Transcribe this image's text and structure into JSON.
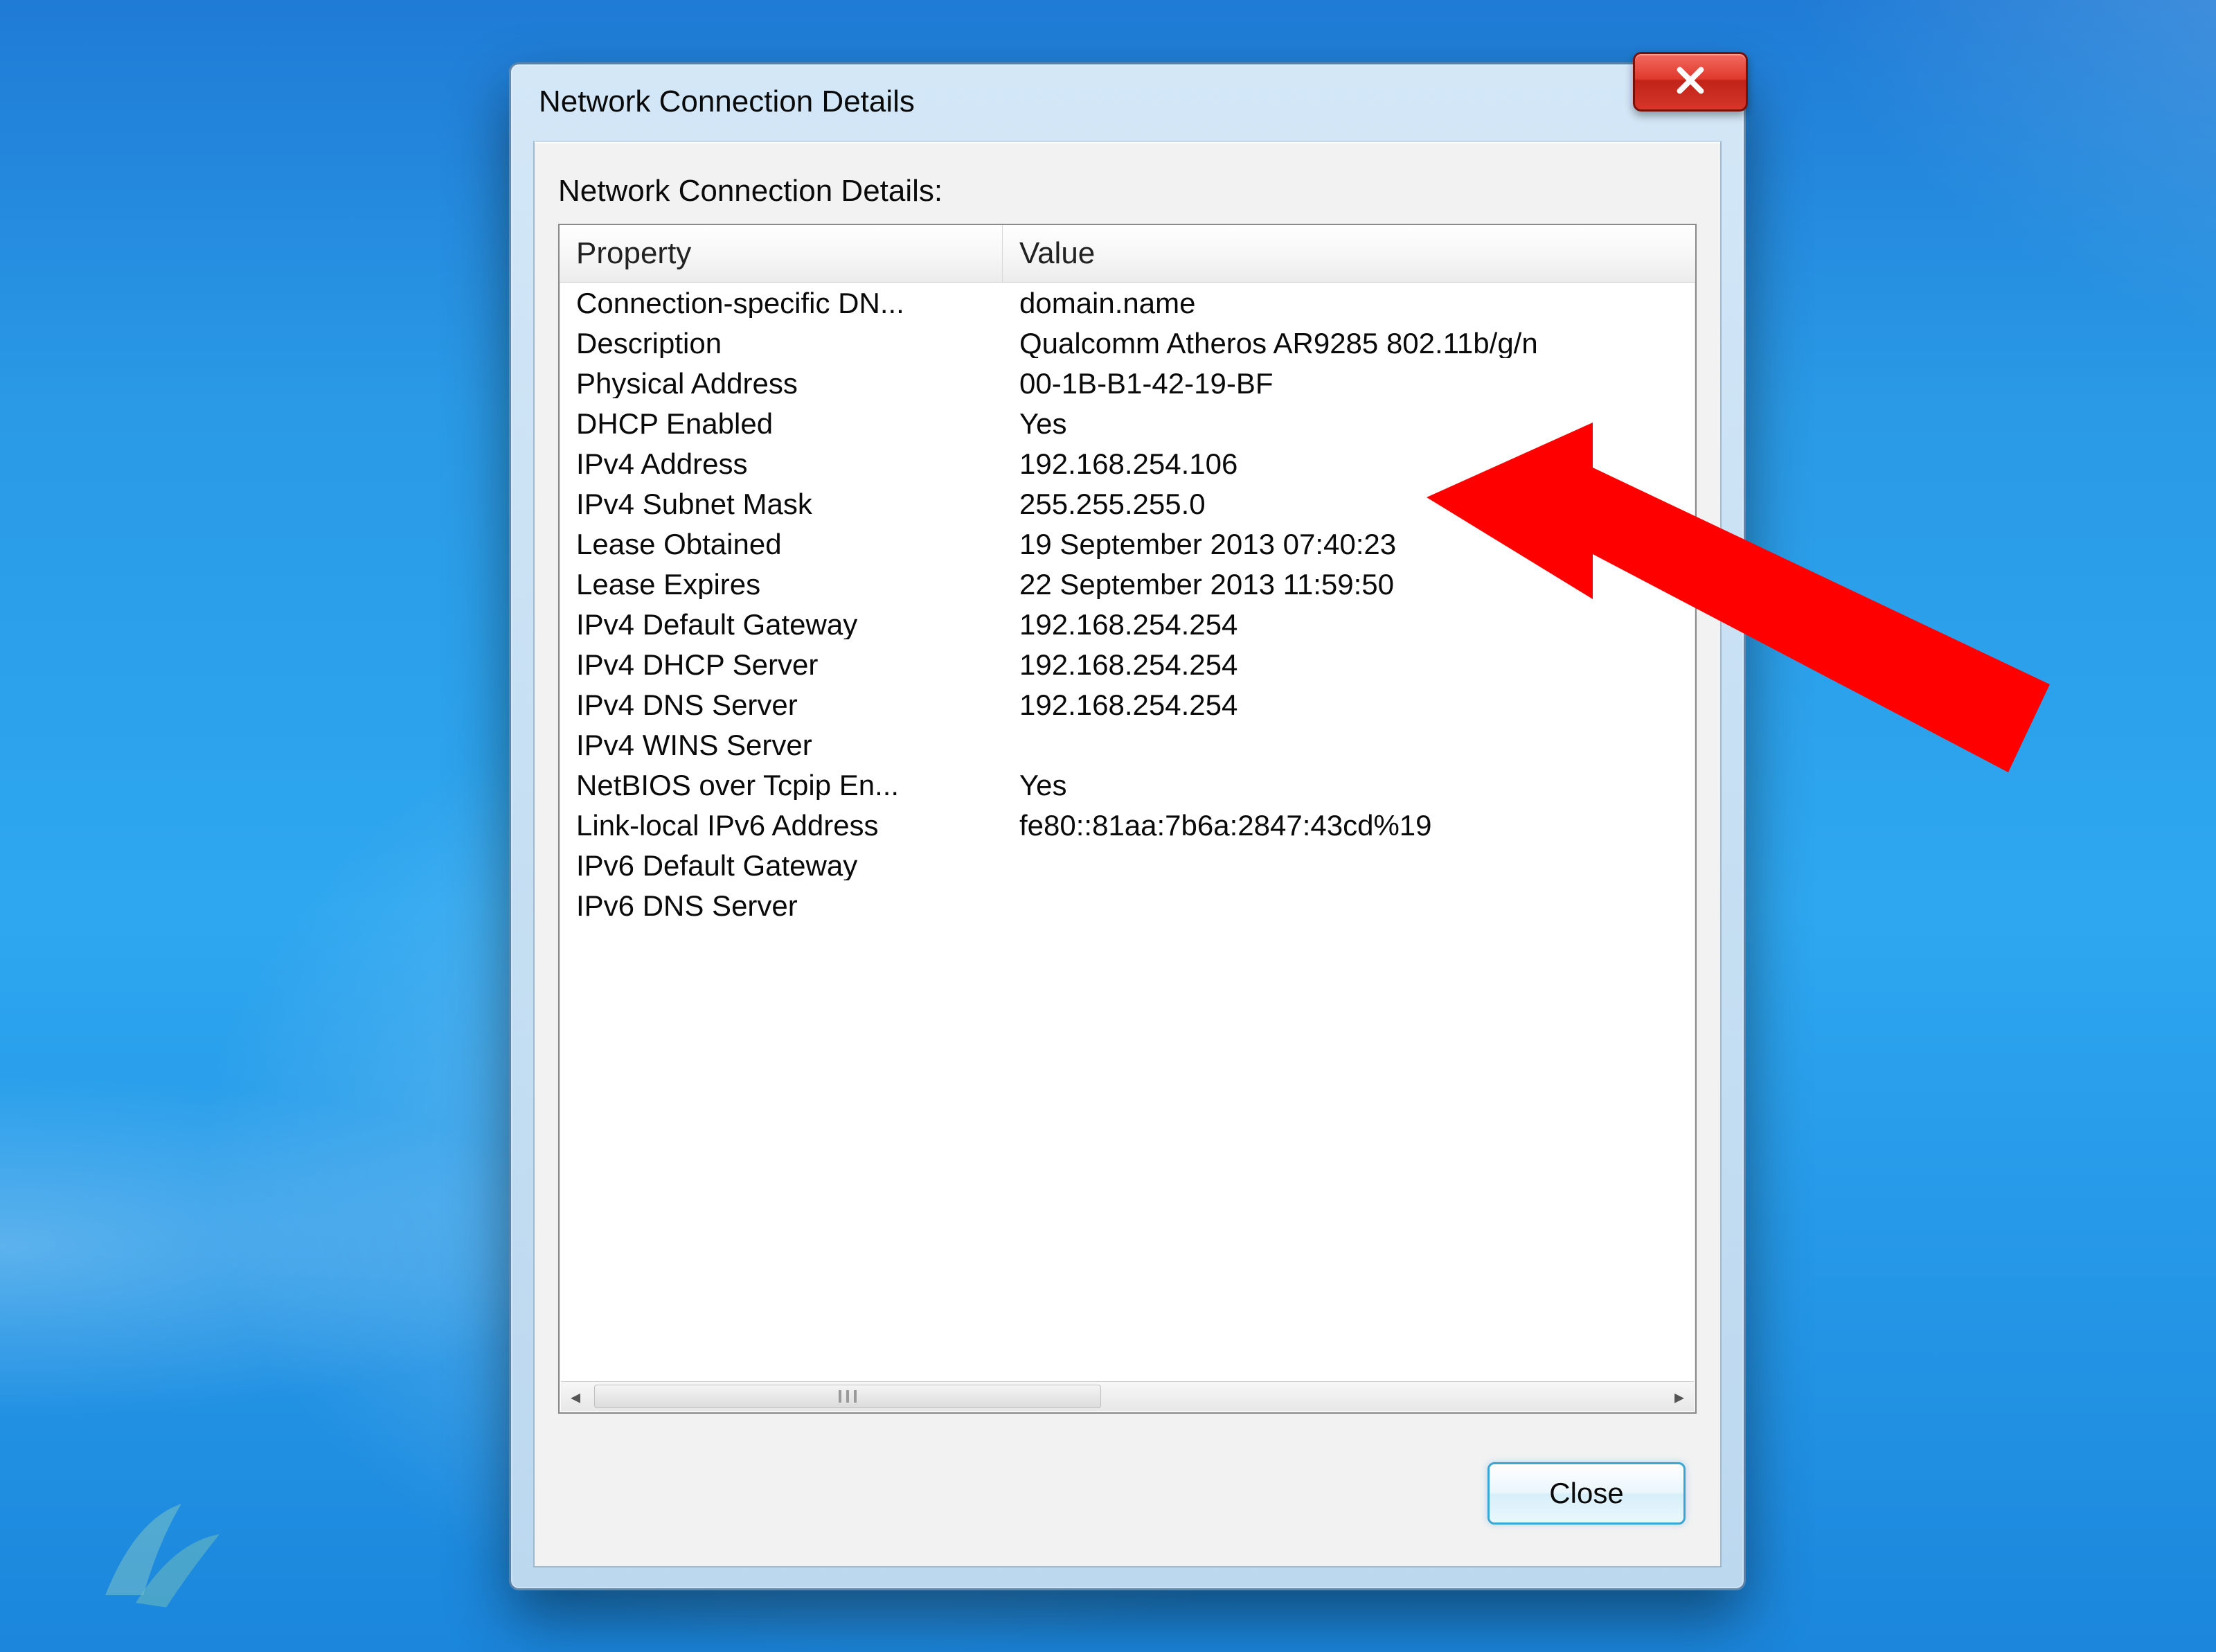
{
  "window": {
    "title": "Network Connection Details",
    "close_glyph": "X"
  },
  "section": {
    "label": "Network Connection Details:"
  },
  "columns": {
    "property": "Property",
    "value": "Value"
  },
  "rows": [
    {
      "property": "Connection-specific DN...",
      "value": "domain.name"
    },
    {
      "property": "Description",
      "value": "Qualcomm Atheros AR9285 802.11b/g/n"
    },
    {
      "property": "Physical Address",
      "value": "00-1B-B1-42-19-BF"
    },
    {
      "property": "DHCP Enabled",
      "value": "Yes"
    },
    {
      "property": "IPv4 Address",
      "value": "192.168.254.106"
    },
    {
      "property": "IPv4 Subnet Mask",
      "value": "255.255.255.0"
    },
    {
      "property": "Lease Obtained",
      "value": "19 September 2013 07:40:23"
    },
    {
      "property": "Lease Expires",
      "value": "22 September 2013 11:59:50"
    },
    {
      "property": "IPv4 Default Gateway",
      "value": "192.168.254.254"
    },
    {
      "property": "IPv4 DHCP Server",
      "value": "192.168.254.254"
    },
    {
      "property": "IPv4 DNS Server",
      "value": "192.168.254.254"
    },
    {
      "property": "IPv4 WINS Server",
      "value": ""
    },
    {
      "property": "NetBIOS over Tcpip En...",
      "value": "Yes"
    },
    {
      "property": "Link-local IPv6 Address",
      "value": "fe80::81aa:7b6a:2847:43cd%19"
    },
    {
      "property": "IPv6 Default Gateway",
      "value": ""
    },
    {
      "property": "IPv6 DNS Server",
      "value": ""
    }
  ],
  "buttons": {
    "close": "Close"
  },
  "annotation": {
    "target_row_index": 4,
    "color": "#ff0000"
  }
}
